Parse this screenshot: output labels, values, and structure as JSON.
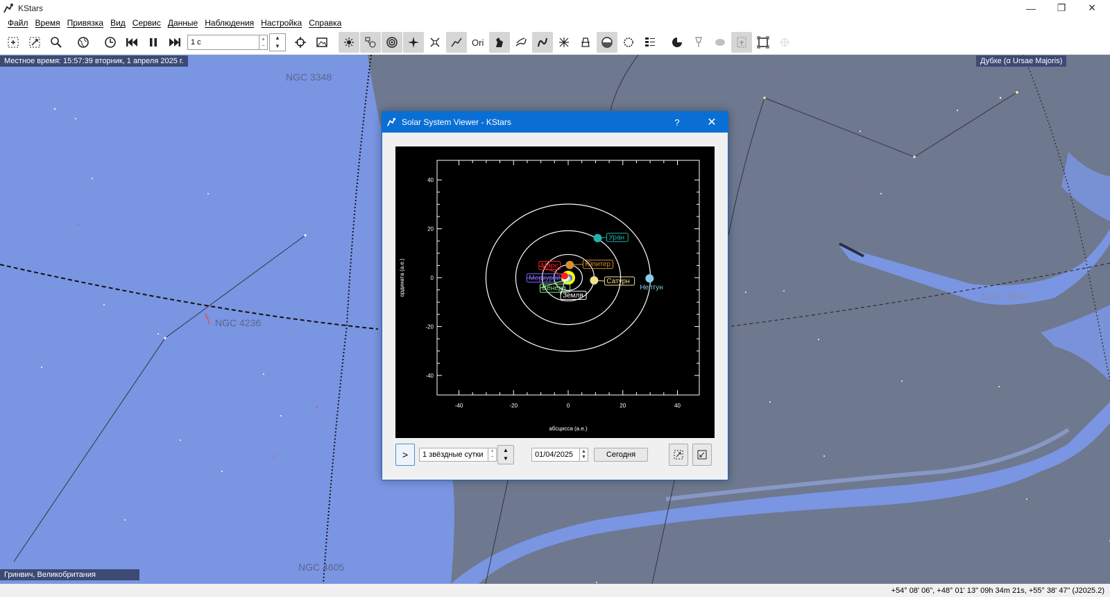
{
  "window": {
    "title": "KStars",
    "minimize_glyph": "—",
    "maximize_glyph": "❐",
    "close_glyph": "✕"
  },
  "menu": [
    "Файл",
    "Время",
    "Привязка",
    "Вид",
    "Сервис",
    "Данные",
    "Наблюдения",
    "Настройка",
    "Справка"
  ],
  "toolbar": {
    "timestep_value": "1 c",
    "icons": [
      "zoom-in-icon",
      "zoom-out-icon",
      "find-icon",
      "globe-icon",
      "clock-icon",
      "step-back-icon",
      "pause-icon",
      "step-forward-icon"
    ]
  },
  "sky": {
    "local_time": "Местное время: 15:57:39   вторник, 1 апреля 2025 г.",
    "focus_object": "Дубхе (α Ursae Majoris)",
    "location": "Гринвич, Великобритания",
    "labels": {
      "ngc3348": "NGC 3348",
      "ngc4236": "NGC 4236",
      "ngc3148": "NGC 3148",
      "ngc4605": "NGC 4605"
    },
    "colors": {
      "sky_blue": "#7a95e2",
      "grey_region": "#6e788f"
    }
  },
  "status": {
    "coordinates": "+54° 08' 06\", +48° 01' 13\"  09h 34m 21s, +55° 38' 47\" (J2025.2)"
  },
  "dialog": {
    "title": "Solar System Viewer - KStars",
    "help_glyph": "?",
    "close_glyph": "✕",
    "controls": {
      "play_glyph": ">",
      "step_value": "1 звёздные сутки",
      "date_value": "01/04/2025",
      "today_label": "Сегодня"
    }
  },
  "chart_data": {
    "type": "scatter",
    "xlabel": "абсцисса (а.е.)",
    "ylabel": "ордината (а.е.)",
    "xlim": [
      -48,
      48
    ],
    "ylim": [
      -48,
      48
    ],
    "xticks": [
      "-40",
      "-20",
      "0",
      "20",
      "40"
    ],
    "yticks": [
      "40",
      "20",
      "0",
      "-20",
      "-40"
    ],
    "grid": false,
    "orbits_au": [
      0.39,
      0.72,
      1.0,
      1.52,
      5.2,
      9.5,
      19.2,
      30.1
    ],
    "planets": [
      {
        "name": "Меркурий",
        "x": 0.35,
        "y": -0.1,
        "color": "#7b68ee"
      },
      {
        "name": "Венера",
        "x": -0.4,
        "y": -0.6,
        "color": "#90ee90"
      },
      {
        "name": "Земля",
        "x": -1.0,
        "y": -0.1,
        "color": "#ffffff"
      },
      {
        "name": "Марс",
        "x": -1.3,
        "y": 0.7,
        "color": "#ff2020"
      },
      {
        "name": "Юпитер",
        "x": 0.6,
        "y": 5.2,
        "color": "#d49030"
      },
      {
        "name": "Сатурн",
        "x": 9.5,
        "y": -1.1,
        "color": "#f0e090"
      },
      {
        "name": "Уран",
        "x": 10.8,
        "y": 16.2,
        "color": "#20b2aa"
      },
      {
        "name": "Нептун",
        "x": 29.8,
        "y": -0.3,
        "color": "#87ceeb"
      }
    ],
    "sun": {
      "x": 0,
      "y": 0,
      "color": "#ffff00"
    }
  }
}
